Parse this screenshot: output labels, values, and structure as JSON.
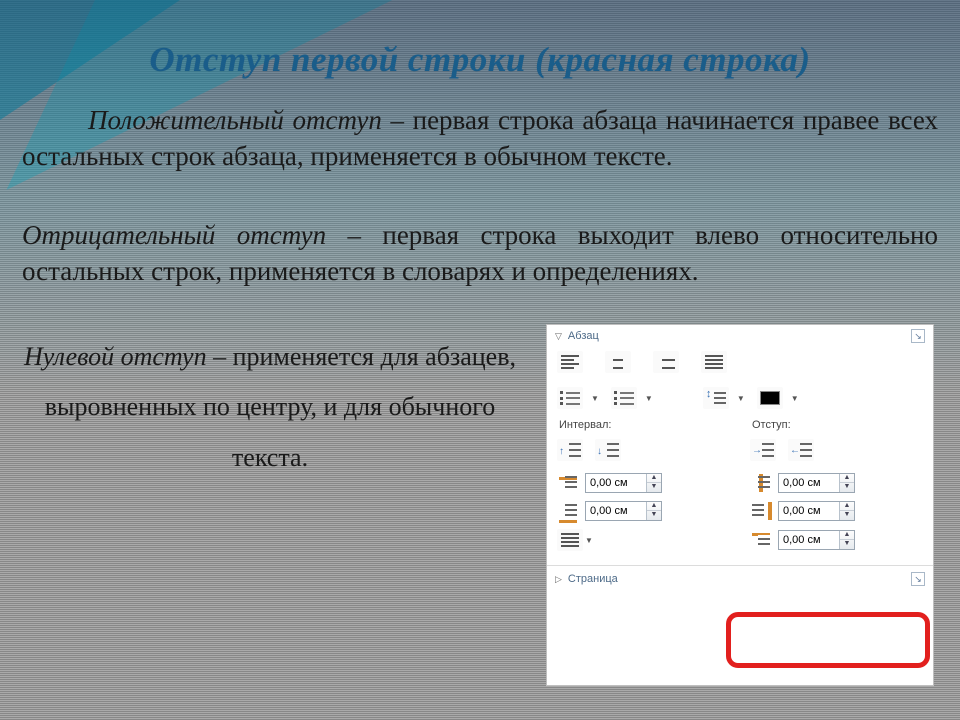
{
  "title": "Отступ первой строки (красная строка)",
  "para_positive": {
    "term": "Положительный отступ",
    "rest": " – первая строка абзаца начинается правее всех остальных строк абзаца, применяется в обычном тексте."
  },
  "para_negative": {
    "term": "Отрицательный отступ",
    "rest": " – первая строка выходит влево относительно остальных строк, применяется в словарях и определениях."
  },
  "para_zero": {
    "term": "Нулевой отступ",
    "rest": " – применяется для абзацев, выровненных по центру, и для обычного текста."
  },
  "panel": {
    "section_paragraph": "Абзац",
    "section_page": "Страница",
    "label_interval": "Интервал:",
    "label_indent": "Отступ:",
    "spin_before_para": "0,00 см",
    "spin_after_para": "0,00 см",
    "spin_before_text": "0,00 см",
    "spin_after_text": "0,00 см",
    "spin_first_line": "0,00 см"
  }
}
